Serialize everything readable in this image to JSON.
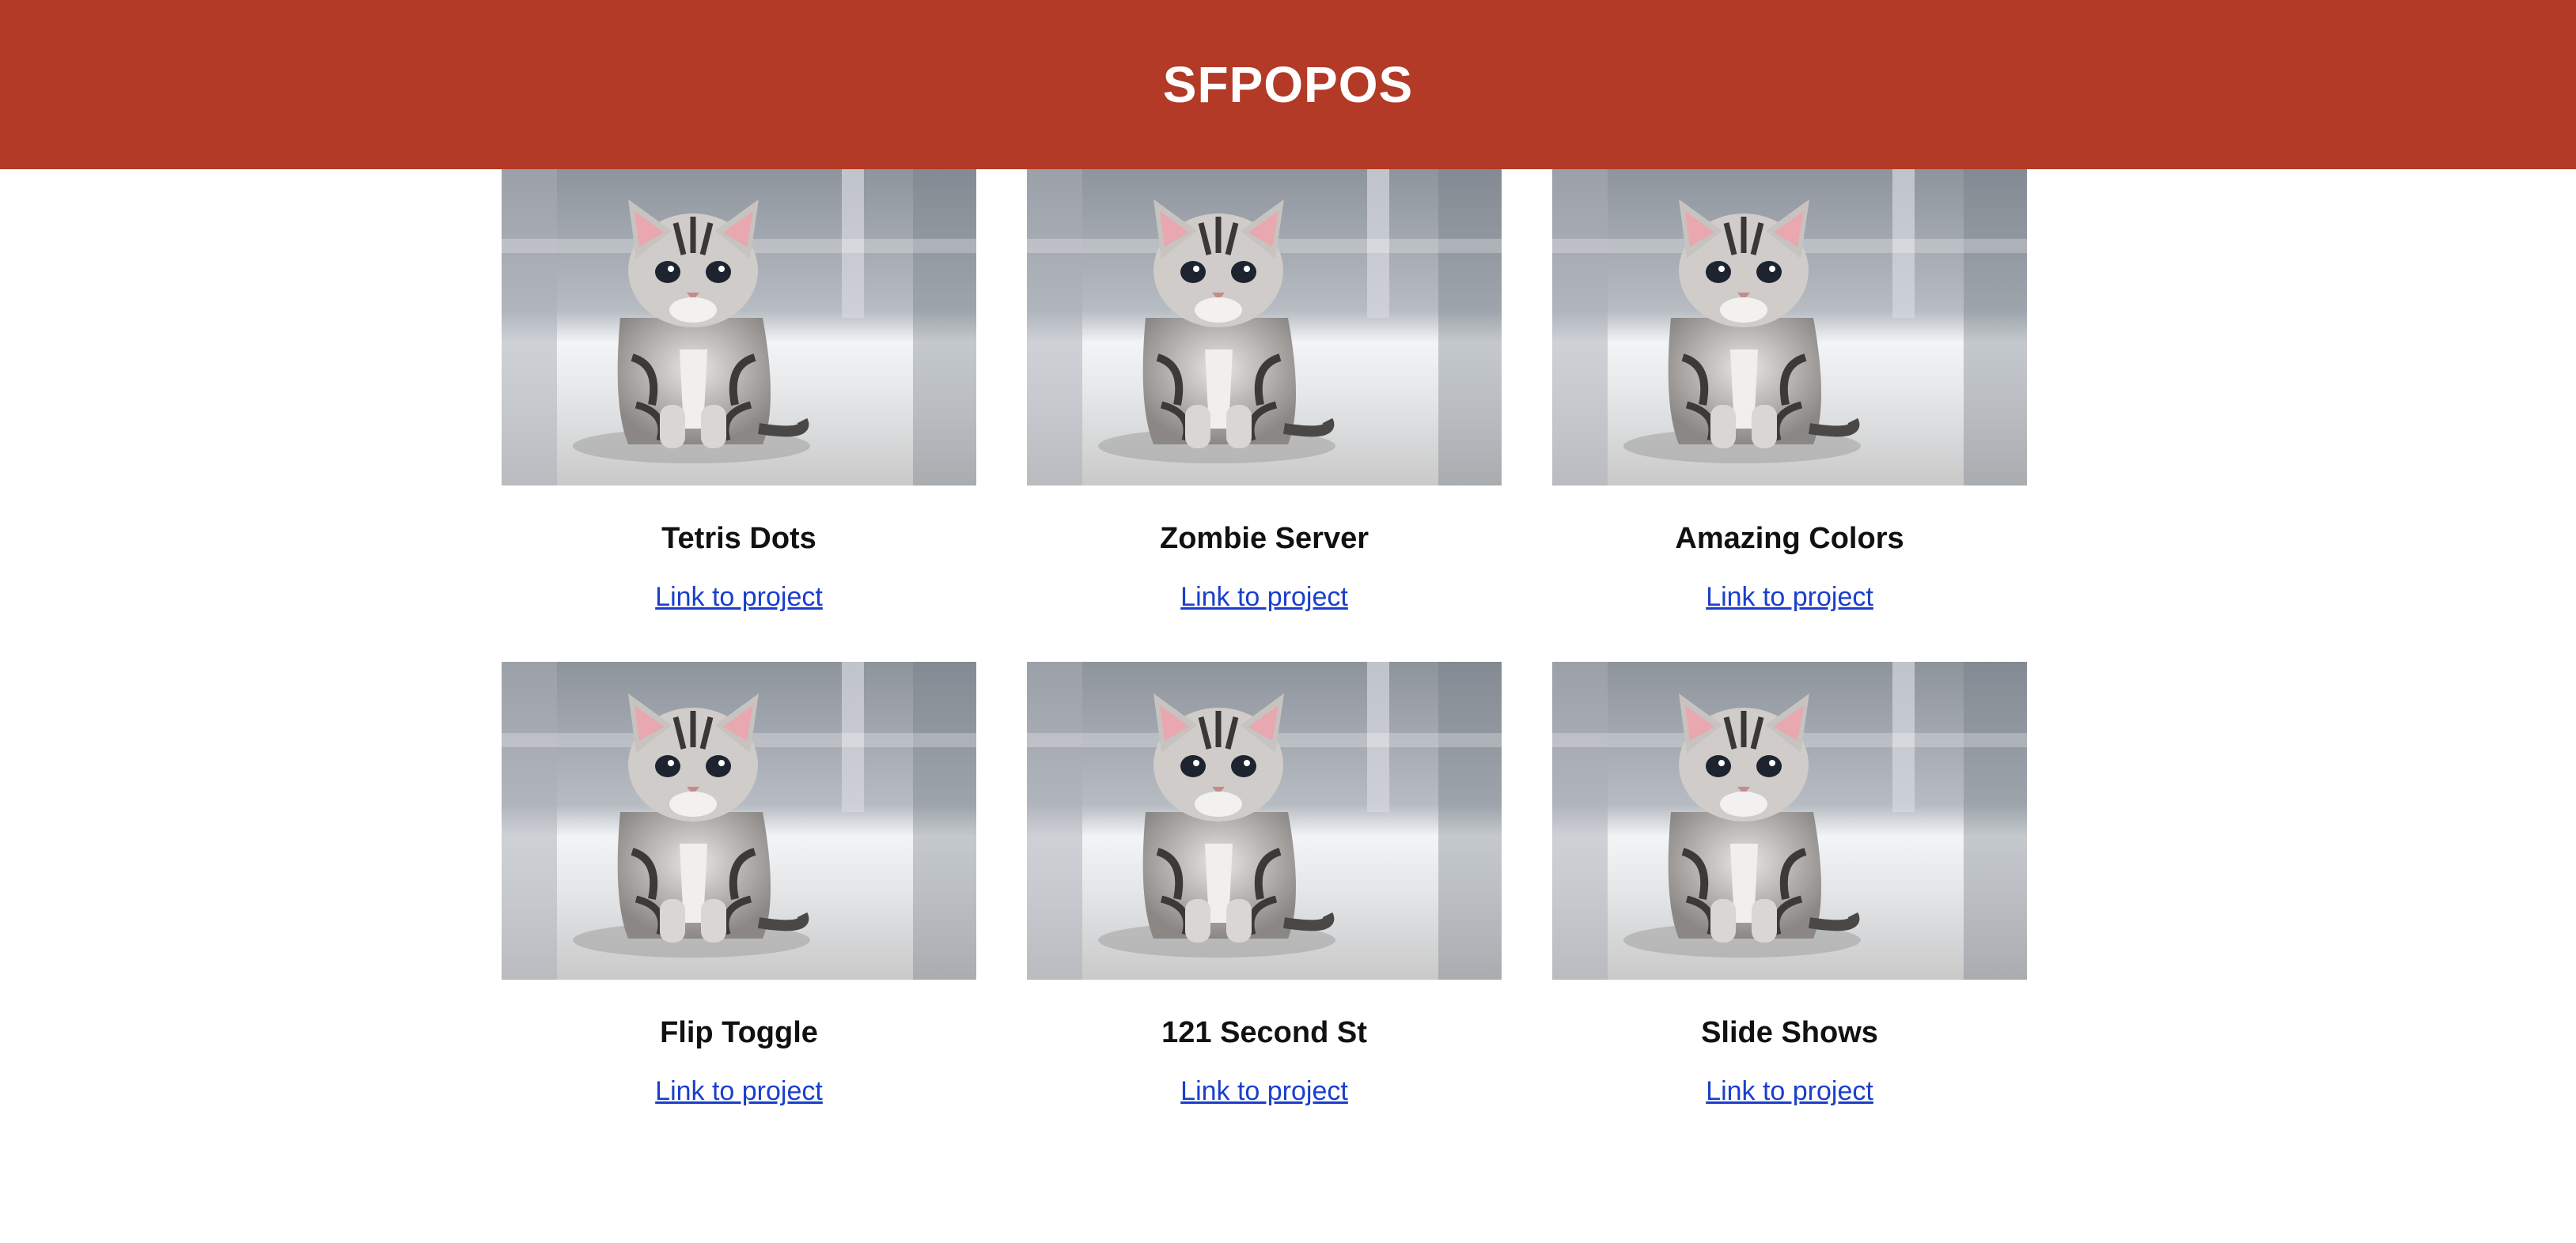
{
  "header": {
    "title": "SFPOPOS"
  },
  "cards": [
    {
      "title": "Tetris Dots",
      "link_label": "Link to project"
    },
    {
      "title": "Zombie Server",
      "link_label": "Link to project"
    },
    {
      "title": "Amazing Colors",
      "link_label": "Link to project"
    },
    {
      "title": "Flip Toggle",
      "link_label": "Link to project"
    },
    {
      "title": "121 Second St",
      "link_label": "Link to project"
    },
    {
      "title": "Slide Shows",
      "link_label": "Link to project"
    }
  ],
  "colors": {
    "header_bg": "#b23a27",
    "header_text": "#ffffff",
    "link": "#1a3fcc",
    "title": "#111111"
  },
  "icons": {
    "thumbnail": "kitten-photo"
  }
}
